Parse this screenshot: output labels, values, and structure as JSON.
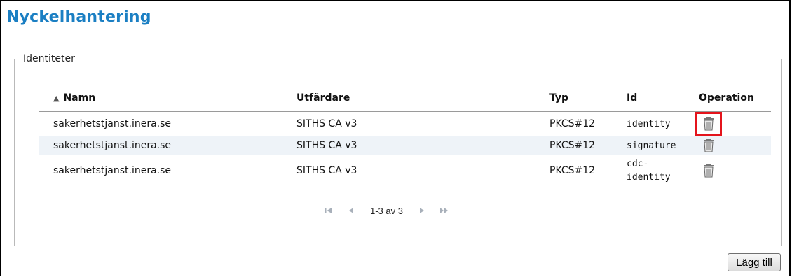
{
  "page": {
    "title": "Nyckelhantering"
  },
  "section": {
    "legend": "Identiteter"
  },
  "table": {
    "headers": {
      "name": "Namn",
      "issuer": "Utfärdare",
      "type": "Typ",
      "id": "Id",
      "operation": "Operation"
    },
    "sort_indicator": "▲",
    "rows": [
      {
        "name": "sakerhetstjanst.inera.se",
        "issuer": "SITHS CA v3",
        "type": "PKCS#12",
        "id": "identity",
        "op_icon": "trash-icon"
      },
      {
        "name": "sakerhetstjanst.inera.se",
        "issuer": "SITHS CA v3",
        "type": "PKCS#12",
        "id": "signature",
        "op_icon": "trash-icon"
      },
      {
        "name": "sakerhetstjanst.inera.se",
        "issuer": "SITHS CA v3",
        "type": "PKCS#12",
        "id_line1": "cdc-",
        "id_line2": "identity",
        "op_icon": "trash-icon"
      }
    ]
  },
  "pager": {
    "text": "1-3 av 3",
    "icons": [
      "first-page-icon",
      "prev-page-icon",
      "next-page-icon",
      "last-page-icon"
    ]
  },
  "actions": {
    "add_label": "Lägg till"
  },
  "colors": {
    "title": "#1b7fc3",
    "highlight": "#e4141c",
    "row_alt": "#eef3f8"
  }
}
